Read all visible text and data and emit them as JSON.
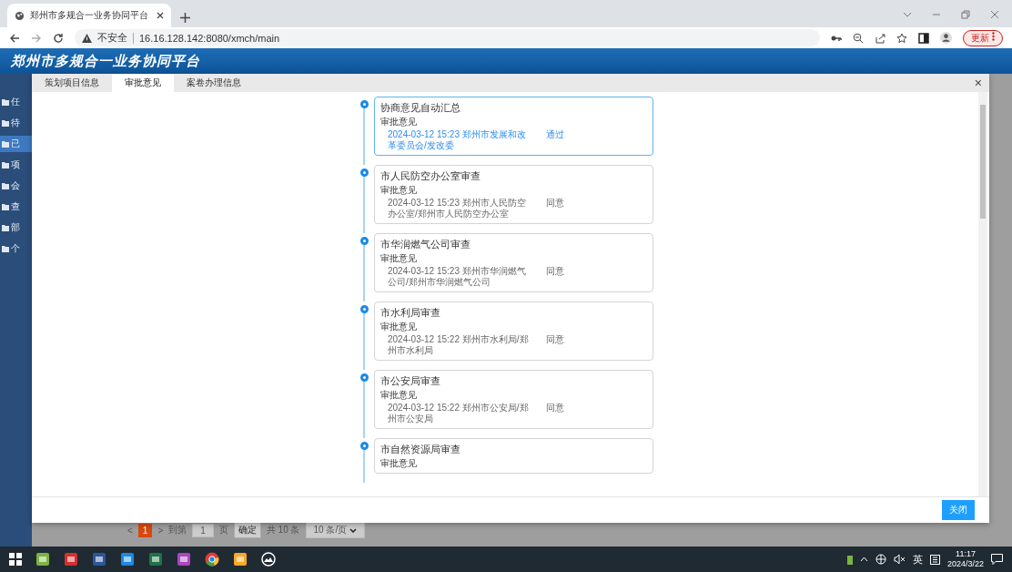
{
  "browser": {
    "tab_title": "郑州市多规合一业务协同平台",
    "security": "不安全",
    "url": "16.16.128.142:8080/xmch/main",
    "update_button": "更新"
  },
  "app": {
    "logo": "郑州市多规合一业务协同平台"
  },
  "sidebar": {
    "items": [
      {
        "label": "任",
        "selected": false
      },
      {
        "label": "待",
        "selected": false
      },
      {
        "label": "已",
        "selected": true
      },
      {
        "label": "项",
        "selected": false
      },
      {
        "label": "会",
        "selected": false
      },
      {
        "label": "查",
        "selected": false
      },
      {
        "label": "部",
        "selected": false
      },
      {
        "label": "个",
        "selected": false
      }
    ]
  },
  "modal": {
    "tabs": [
      {
        "label": "策划项目信息",
        "selected": false
      },
      {
        "label": "审批意见",
        "selected": true
      },
      {
        "label": "案卷办理信息",
        "selected": false
      }
    ],
    "close_icon": "×",
    "timeline": [
      {
        "title": "协商意见自动汇总",
        "label": "审批意见",
        "detail": "2024-03-12 15:23 郑州市发展和改革委员会/发改委",
        "result": "通过",
        "selected": true
      },
      {
        "title": "市人民防空办公室审查",
        "label": "审批意见",
        "detail": "2024-03-12 15:23 郑州市人民防空办公室/郑州市人民防空办公室",
        "result": "同意",
        "selected": false
      },
      {
        "title": "市华润燃气公司审查",
        "label": "审批意见",
        "detail": "2024-03-12 15:23 郑州市华润燃气公司/郑州市华润燃气公司",
        "result": "同意",
        "selected": false
      },
      {
        "title": "市水利局审查",
        "label": "审批意见",
        "detail": "2024-03-12 15:22 郑州市水利局/郑州市水利局",
        "result": "同意",
        "selected": false
      },
      {
        "title": "市公安局审查",
        "label": "审批意见",
        "detail": "2024-03-12 15:22 郑州市公安局/郑州市公安局",
        "result": "同意",
        "selected": false
      },
      {
        "title": "市自然资源局审查",
        "label": "审批意见",
        "selected": false
      }
    ],
    "close_button": "关闭"
  },
  "pagination": {
    "prev": "<",
    "current": "1",
    "next": ">",
    "goto_label": "到第",
    "goto_value": "1",
    "page_label": "页",
    "confirm": "确定",
    "total": "共 10 条",
    "page_size": "10 条/页"
  },
  "taskbar": {
    "ime": "英",
    "time": "11:17",
    "date": "2024/3/22"
  }
}
